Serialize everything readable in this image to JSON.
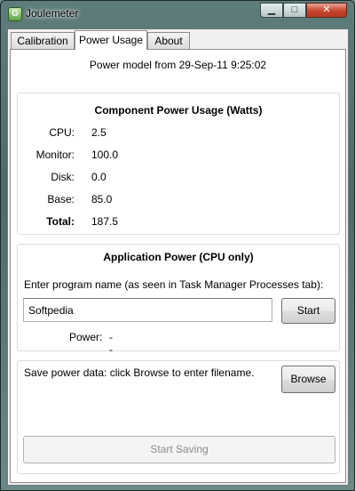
{
  "window": {
    "title": "Joulemeter",
    "app_icon_glyph": "G",
    "minimize_glyph": "▁",
    "maximize_glyph": "□",
    "close_glyph": "✕"
  },
  "tabs": [
    {
      "label": "Calibration",
      "selected": false
    },
    {
      "label": "Power Usage",
      "selected": true
    },
    {
      "label": "About",
      "selected": false
    }
  ],
  "power_model": "Power model from 29-Sep-11 9:25:02",
  "component": {
    "title": "Component Power Usage (Watts)",
    "rows": [
      {
        "label": "CPU:",
        "value": "2.5"
      },
      {
        "label": "Monitor:",
        "value": "100.0"
      },
      {
        "label": "Disk:",
        "value": "0.0"
      },
      {
        "label": "Base:",
        "value": "85.0"
      },
      {
        "label": "Total:",
        "value": "187.5"
      }
    ]
  },
  "application": {
    "title": "Application Power (CPU only)",
    "prompt": "Enter program name (as seen in Task Manager Processes tab):",
    "program_value": "Softpedia",
    "start_label": "Start",
    "power_label": "Power:",
    "power_value": "--"
  },
  "saving": {
    "text": "Save power data: click Browse to enter filename.",
    "browse_label": "Browse",
    "start_saving_label": "Start Saving"
  }
}
